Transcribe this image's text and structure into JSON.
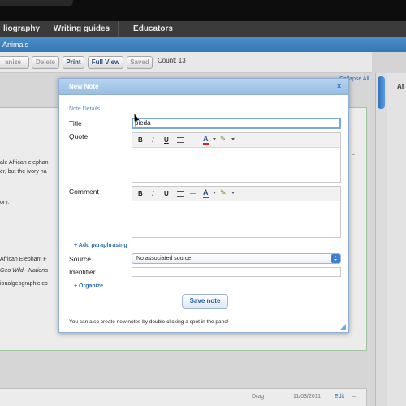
{
  "nav": {
    "items": [
      {
        "label": "liography"
      },
      {
        "label": "Writing guides"
      },
      {
        "label": "Educators"
      }
    ]
  },
  "breadcrumb": {
    "label": "Animals"
  },
  "toolbar": {
    "buttons": [
      {
        "label": "anize",
        "enabled": false
      },
      {
        "label": "Delete",
        "enabled": false
      },
      {
        "label": "Print",
        "enabled": true
      },
      {
        "label": "Full View",
        "enabled": true
      },
      {
        "label": "Saved",
        "enabled": false
      }
    ],
    "count_label": "Count: 13"
  },
  "panel": {
    "collapse_all": "Collapse All",
    "right_label": "Af"
  },
  "background_note": {
    "lines": [
      {
        "text": "ale African elephan"
      },
      {
        "text": "er, but the ivory ha"
      },
      {
        "text": "ory."
      },
      {
        "text": "African Elephant F"
      },
      {
        "text": "Geo Wild - Nationa"
      },
      {
        "text": "ionalgeographic.co"
      }
    ]
  },
  "bottom_note": {
    "drag": "Drag",
    "meta": "11/03/2011",
    "edit": "Edit"
  },
  "modal": {
    "title": "New Note",
    "close": "×",
    "section": "Note Details",
    "title_label": "Title",
    "title_value": "pieda",
    "quote_label": "Quote",
    "comment_label": "Comment",
    "add_paraphrasing": "+ Add paraphrasing",
    "source_label": "Source",
    "source_value": "No associated source",
    "identifier_label": "Identifier",
    "identifier_value": "",
    "organize": "+ Organize",
    "save": "Save note",
    "footer": "You can also create new notes by double clicking a spot in the pane!"
  },
  "rte": {
    "bold": "B",
    "italic": "I",
    "underline": "U",
    "font_color": "A",
    "highlight": "✎"
  },
  "colors": {
    "accent": "#3677b3",
    "modal_header": "#98bde4",
    "link": "#2a6bb3"
  }
}
